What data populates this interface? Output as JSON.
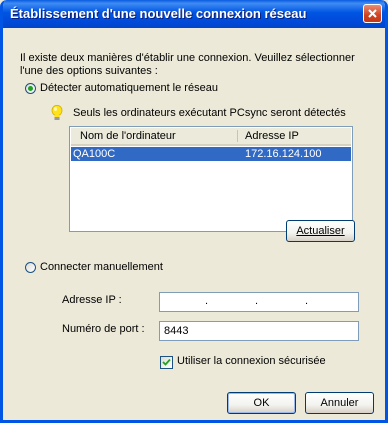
{
  "window": {
    "title": "Établissement d'une nouvelle connexion réseau"
  },
  "intro": "Il existe deux manières d'établir une connexion. Veuillez sélectionner l'une des options suivantes :",
  "auto": {
    "radio_label": "Détecter automatiquement le réseau",
    "selected": true,
    "hint": "Seuls les ordinateurs exécutant PCsync seront détectés",
    "columns": [
      "Nom de l'ordinateur",
      "Adresse IP"
    ],
    "rows": [
      {
        "name": "QA100C",
        "ip": "172.16.124.100",
        "selected": true
      }
    ],
    "refresh_label": "Actualiser"
  },
  "manual": {
    "radio_label": "Connecter  manuellement",
    "selected": false,
    "ip_label": "Adresse IP :",
    "ip_value": "",
    "ip_separators": [
      ".",
      ".",
      "."
    ],
    "port_label": "Numéro de port :",
    "port_value": "8443",
    "secure_label": "Utiliser la connexion sécurisée",
    "secure_checked": true
  },
  "buttons": {
    "ok": "OK",
    "cancel": "Annuler"
  },
  "colors": {
    "titlebar": "#0054e3",
    "selection": "#316ac5",
    "dialog_bg": "#ece9d8"
  }
}
